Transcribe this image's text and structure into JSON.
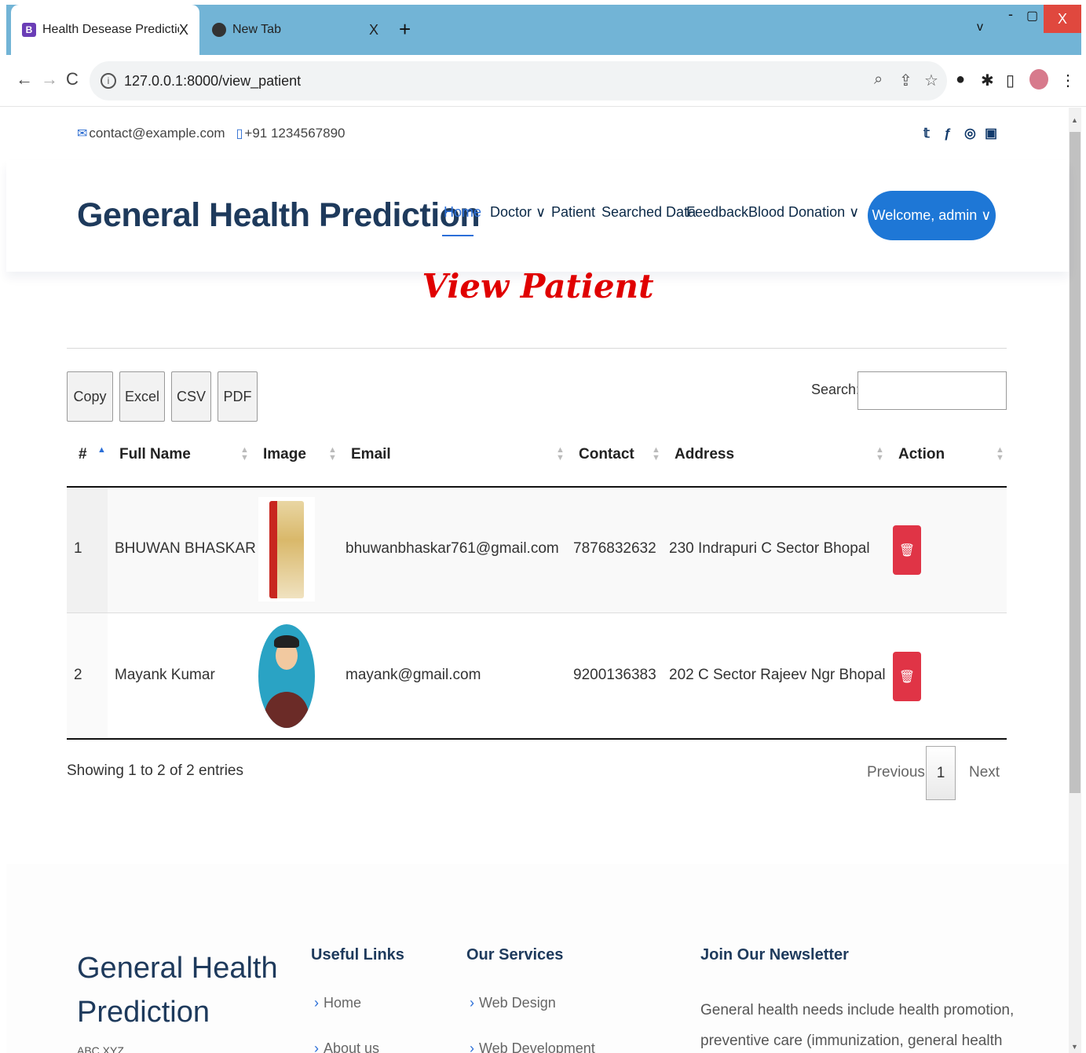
{
  "browser": {
    "tabs": [
      {
        "favicon": "B",
        "title": "Health Desease Prediction",
        "close": "X"
      },
      {
        "favicon": "",
        "title": "New Tab",
        "close": "X"
      }
    ],
    "new_tab": "+",
    "url": "127.0.0.1:8000/view_patient",
    "window": {
      "chevron": "v",
      "minimize": "-",
      "restore": "▢",
      "close": "X"
    }
  },
  "topbar": {
    "email": "contact@example.com",
    "phone": "+91 1234567890"
  },
  "header": {
    "logo": "General Health Prediction",
    "nav": [
      {
        "label": "Home"
      },
      {
        "label": "Doctor ∨"
      },
      {
        "label": "Patient"
      },
      {
        "label": "Searched Data"
      },
      {
        "label": "Feedback"
      },
      {
        "label": "Blood Donation ∨"
      }
    ],
    "welcome": "Welcome, admin ∨"
  },
  "page": {
    "title": "View Patient"
  },
  "datatable": {
    "buttons": [
      "Copy",
      "Excel",
      "CSV",
      "PDF"
    ],
    "search_label": "Search:",
    "columns": [
      "#",
      "Full Name",
      "Image",
      "Email",
      "Contact",
      "Address",
      "Action"
    ],
    "rows": [
      {
        "index": "1",
        "name": "BHUWAN BHASKAR",
        "email": "bhuwanbhaskar761@gmail.com",
        "contact": "7876832632",
        "address": "230 Indrapuri C Sector Bhopal"
      },
      {
        "index": "2",
        "name": "Mayank Kumar",
        "email": "mayank@gmail.com",
        "contact": "9200136383",
        "address": "202 C Sector Rajeev Ngr Bhopal"
      }
    ],
    "info": "Showing 1 to 2 of 2 entries",
    "pagination": {
      "previous": "Previous",
      "page": "1",
      "next": "Next"
    }
  },
  "footer": {
    "brand_line1": "General Health",
    "brand_line2": "Prediction",
    "brand_small": "ABC XYZ",
    "useful_links": {
      "heading": "Useful Links",
      "items": [
        "Home",
        "About us"
      ]
    },
    "services": {
      "heading": "Our Services",
      "items": [
        "Web Design",
        "Web Development"
      ]
    },
    "newsletter": {
      "heading": "Join Our Newsletter",
      "text": "General health needs include health promotion, preventive care (immunization, general health"
    }
  },
  "colors": {
    "accent": "#1e77d6",
    "title_red": "#e00000",
    "danger": "#e03446",
    "tabbar": "#72b4d6"
  }
}
